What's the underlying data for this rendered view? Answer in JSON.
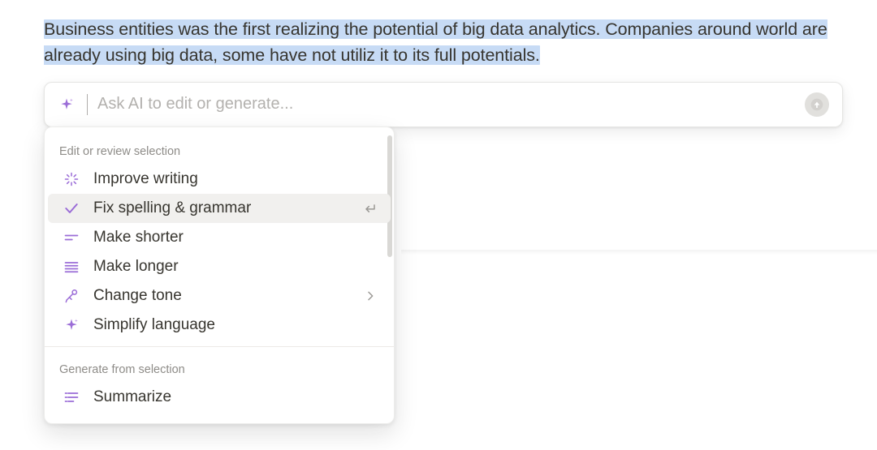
{
  "selected_text": "Business entities was the first realizing the potential of big data analytics. Companies around world are already using big data, some have not utiliz it to its full potentials.",
  "input": {
    "placeholder": "Ask AI to edit or generate..."
  },
  "sections": {
    "edit_header": "Edit or review selection",
    "generate_header": "Generate from selection"
  },
  "menu": {
    "improve": "Improve writing",
    "fix": "Fix spelling & grammar",
    "shorter": "Make shorter",
    "longer": "Make longer",
    "tone": "Change tone",
    "simplify": "Simplify language",
    "summarize": "Summarize"
  },
  "colors": {
    "accent": "#9b6dd7"
  }
}
